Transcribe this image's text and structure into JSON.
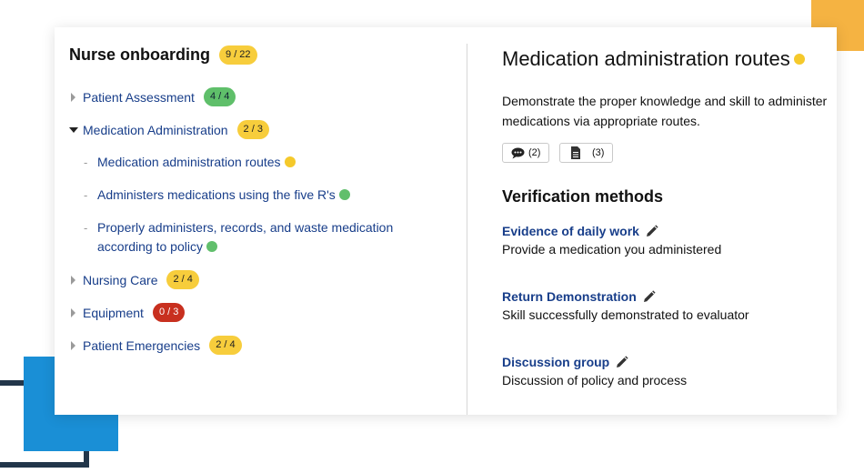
{
  "header": {
    "title": "Nurse onboarding",
    "progress": "9 / 22"
  },
  "tree": [
    {
      "label": "Patient Assessment",
      "progress": "4 / 4",
      "status": "green",
      "expanded": false
    },
    {
      "label": "Medication Administration",
      "progress": "2 / 3",
      "status": "yellow",
      "expanded": true,
      "children": [
        {
          "label": "Medication administration routes",
          "status": "yellow"
        },
        {
          "label": "Administers medications using the five R's",
          "status": "green"
        },
        {
          "label_line1": "Properly administers, records, and waste medication",
          "label_line2": "according to policy",
          "status": "green"
        }
      ]
    },
    {
      "label": "Nursing Care",
      "progress": "2 / 4",
      "status": "yellow",
      "expanded": false
    },
    {
      "label": "Equipment",
      "progress": "0 / 3",
      "status": "red",
      "expanded": false
    },
    {
      "label": "Patient Emergencies",
      "progress": "2 / 4",
      "status": "yellow",
      "expanded": false
    }
  ],
  "detail": {
    "title": "Medication administration routes",
    "description": "Demonstrate the proper knowledge and skill to administer medications via appropriate routes.",
    "comments_count": "(2)",
    "documents_count": "(3)",
    "verification_heading": "Verification methods",
    "methods": [
      {
        "name": "Evidence of daily work",
        "description": "Provide a medication you administered"
      },
      {
        "name": "Return Demonstration",
        "description": "Skill successfully demonstrated to evaluator"
      },
      {
        "name": "Discussion group",
        "description": "Discussion of policy and process"
      }
    ]
  },
  "colors": {
    "link": "#183e8a",
    "yellow": "#f7cd3c",
    "green": "#5fbf6a",
    "red": "#c8301f",
    "orange_accent": "#f5b342",
    "blue_accent": "#1a8fd6",
    "navy_accent": "#22364a"
  }
}
